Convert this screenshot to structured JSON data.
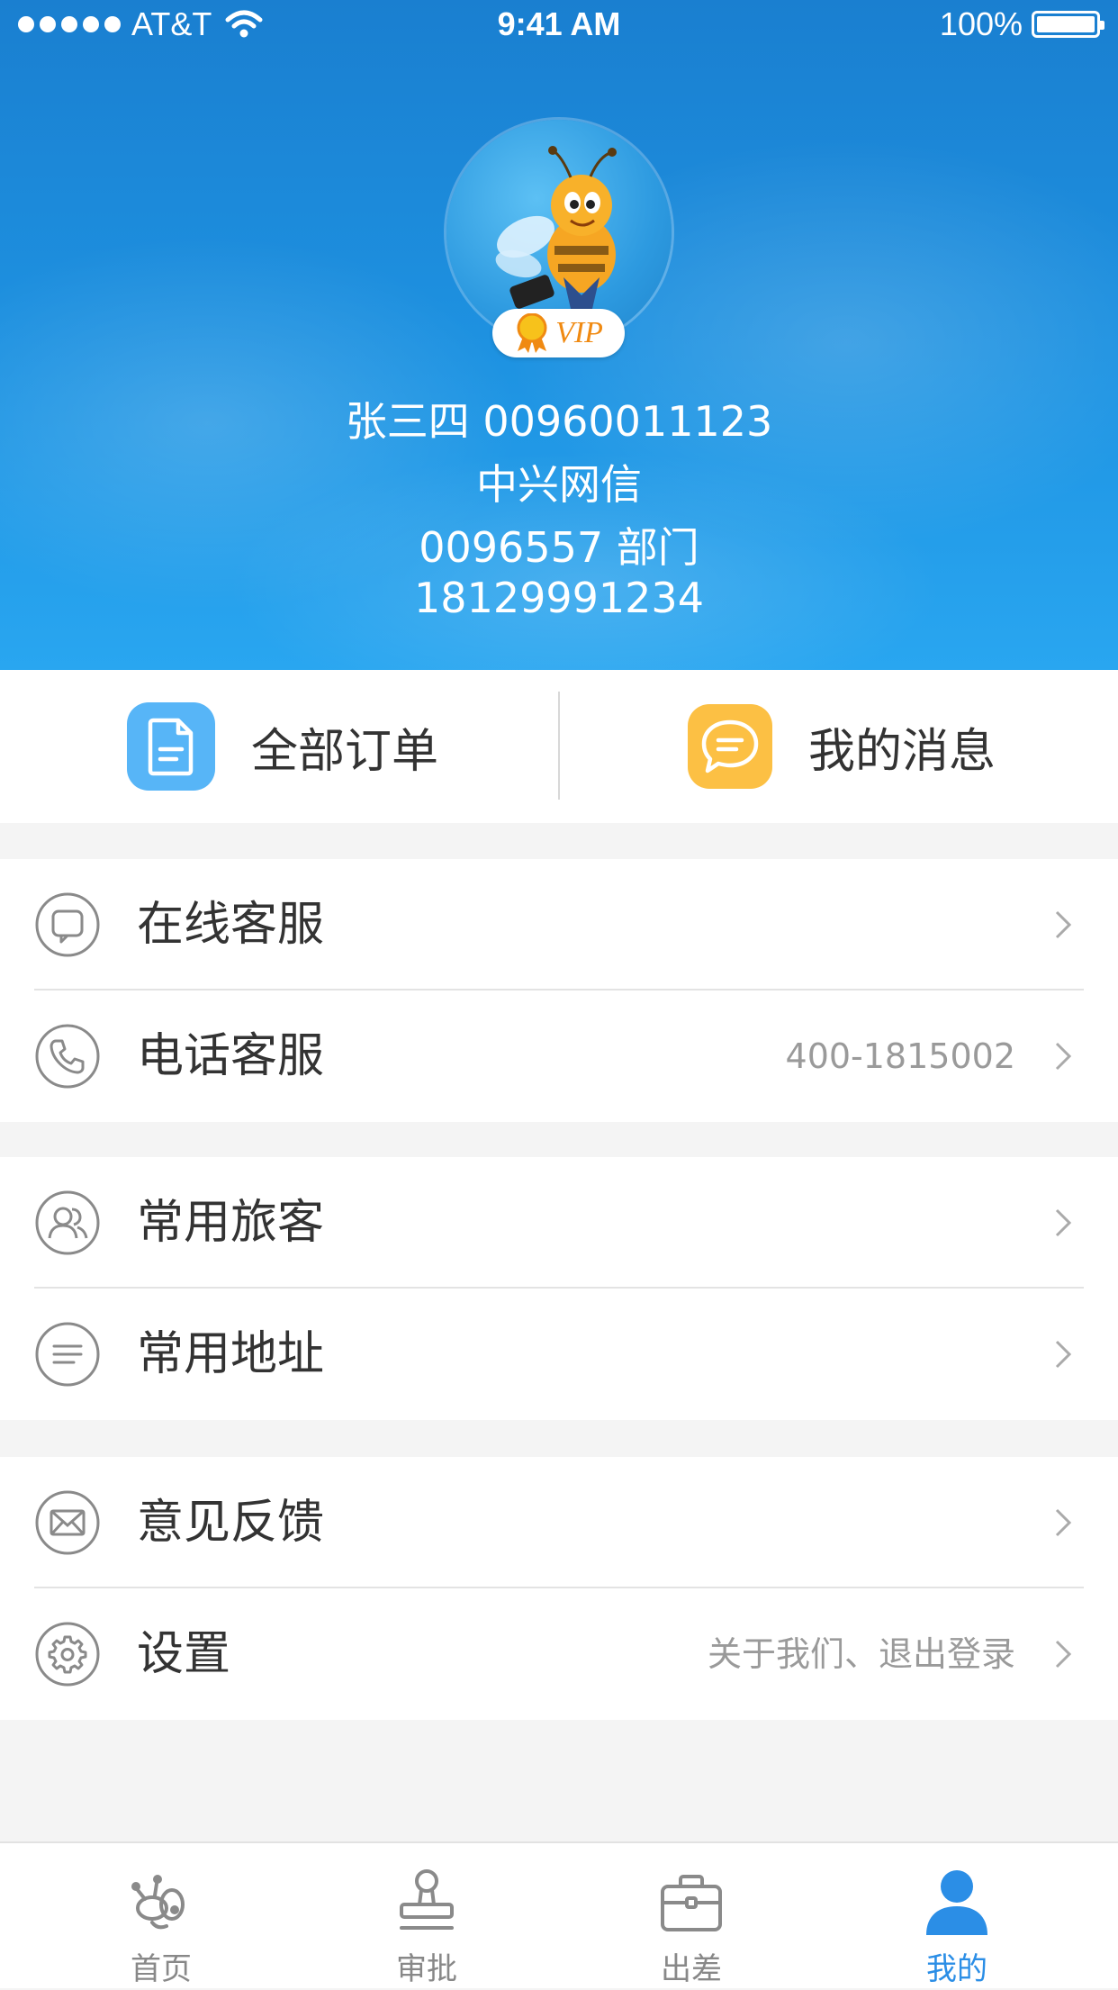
{
  "status_bar": {
    "carrier": "AT&T",
    "time": "9:41 AM",
    "battery": "100%"
  },
  "profile": {
    "vip_label": "VIP",
    "name_line": "张三四  00960011123",
    "company": "中兴网信",
    "department": "0096557 部门",
    "phone": "18129991234"
  },
  "quick_actions": {
    "orders": "全部订单",
    "messages": "我的消息"
  },
  "menu": {
    "online_service": "在线客服",
    "phone_service": "电话客服",
    "phone_service_value": "400-1815002",
    "frequent_travelers": "常用旅客",
    "frequent_addresses": "常用地址",
    "feedback": "意见反馈",
    "settings": "设置",
    "settings_value": "关于我们、退出登录"
  },
  "tabs": [
    {
      "label": "首页",
      "icon": "bee-logo-icon"
    },
    {
      "label": "审批",
      "icon": "stamp-icon"
    },
    {
      "label": "出差",
      "icon": "briefcase-icon"
    },
    {
      "label": "我的",
      "icon": "user-icon",
      "active": true
    }
  ],
  "colors": {
    "header_blue": "#1e93e2",
    "orders_icon_bg": "#57b5f7",
    "messages_icon_bg": "#fcc044",
    "active_tab": "#2b8ee6"
  }
}
